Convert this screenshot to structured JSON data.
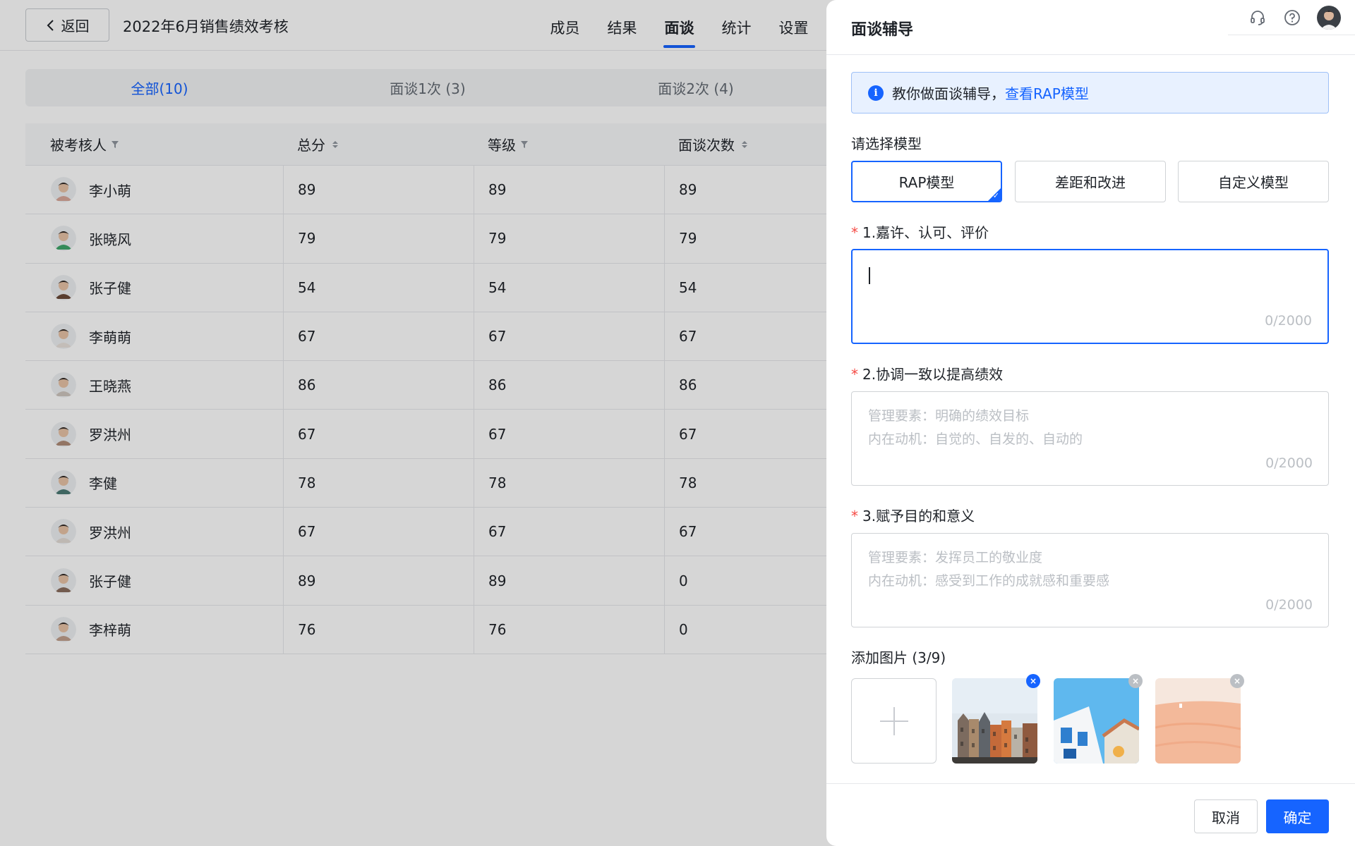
{
  "header": {
    "back_label": "返回",
    "title": "2022年6月销售绩效考核",
    "tabs": [
      {
        "label": "成员",
        "active": false
      },
      {
        "label": "结果",
        "active": false
      },
      {
        "label": "面谈",
        "active": true
      },
      {
        "label": "统计",
        "active": false
      },
      {
        "label": "设置",
        "active": false
      }
    ]
  },
  "filter_tabs": [
    {
      "label": "全部(10)",
      "active": true
    },
    {
      "label": "面谈1次 (3)",
      "active": false
    },
    {
      "label": "面谈2次 (4)",
      "active": false
    }
  ],
  "table": {
    "columns": [
      "被考核人",
      "总分",
      "等级",
      "面谈次数"
    ],
    "rows": [
      {
        "name": "李小萌",
        "score": "89",
        "grade": "89",
        "count": "89",
        "avatar_color": "#d9a89a"
      },
      {
        "name": "张晓风",
        "score": "79",
        "grade": "79",
        "count": "79",
        "avatar_color": "#3fa66b"
      },
      {
        "name": "张子健",
        "score": "54",
        "grade": "54",
        "count": "54",
        "avatar_color": "#6b4a3a"
      },
      {
        "name": "李萌萌",
        "score": "67",
        "grade": "67",
        "count": "67",
        "avatar_color": "#e9e2dc"
      },
      {
        "name": "王晓燕",
        "score": "86",
        "grade": "86",
        "count": "86",
        "avatar_color": "#cfc6bf"
      },
      {
        "name": "罗洪州",
        "score": "67",
        "grade": "67",
        "count": "67",
        "avatar_color": "#b08c78"
      },
      {
        "name": "李健",
        "score": "78",
        "grade": "78",
        "count": "78",
        "avatar_color": "#4c7a74"
      },
      {
        "name": "罗洪州",
        "score": "67",
        "grade": "67",
        "count": "67",
        "avatar_color": "#e3dcd6"
      },
      {
        "name": "张子健",
        "score": "89",
        "grade": "89",
        "count": "0",
        "avatar_color": "#8a6d5e"
      },
      {
        "name": "李梓萌",
        "score": "76",
        "grade": "76",
        "count": "0",
        "avatar_color": "#c2a08d"
      }
    ]
  },
  "drawer": {
    "title": "面谈辅导",
    "info_text": "教你做面谈辅导，",
    "info_link": "查看RAP模型",
    "model_label": "请选择模型",
    "models": [
      {
        "label": "RAP模型",
        "active": true
      },
      {
        "label": "差距和改进",
        "active": false
      },
      {
        "label": "自定义模型",
        "active": false
      }
    ],
    "sections": [
      {
        "label": "1.嘉许、认可、评价",
        "line1": "",
        "line2": "",
        "counter": "0/2000"
      },
      {
        "label": "2.协调一致以提高绩效",
        "line1": "管理要素：明确的绩效目标",
        "line2": "内在动机：自觉的、自发的、自动的",
        "counter": "0/2000"
      },
      {
        "label": "3.赋予目的和意义",
        "line1": "管理要素：发挥员工的敬业度",
        "line2": "内在动机：感受到工作的成就感和重要感",
        "counter": "0/2000"
      }
    ],
    "images_label": "添加图片 (3/9)",
    "cancel_label": "取消",
    "ok_label": "确定"
  },
  "colors": {
    "accent": "#1664ff",
    "required": "#f54a45"
  }
}
